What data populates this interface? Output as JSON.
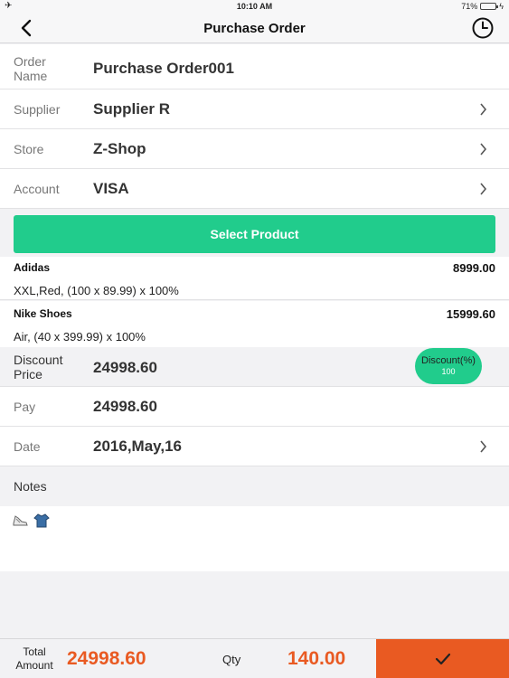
{
  "status_bar": {
    "time": "10:10 AM",
    "battery": "71%",
    "battery_level": 0.71
  },
  "nav": {
    "title": "Purchase Order"
  },
  "form": {
    "order_name_label_line1": "Order",
    "order_name_label_line2": "Name",
    "order_name_value": "Purchase Order001",
    "supplier_label": "Supplier",
    "supplier_value": "Supplier R",
    "store_label": "Store",
    "store_value": "Z-Shop",
    "account_label": "Account",
    "account_value": "VISA"
  },
  "select_product_label": "Select Product",
  "products": [
    {
      "name": "Adidas",
      "price": "8999.00",
      "desc": "XXL,Red, (100  x 89.99) x 100%"
    },
    {
      "name": "Nike Shoes",
      "price": "15999.60",
      "desc": "Air, (40  x 399.99) x 100%"
    }
  ],
  "discount": {
    "label_line1": "Discount",
    "label_line2": "Price",
    "value": "24998.60",
    "badge_title": "Discount(%)",
    "badge_value": "100"
  },
  "pay": {
    "label": "Pay",
    "value": "24998.60"
  },
  "date": {
    "label": "Date",
    "value": "2016,May,16"
  },
  "notes": {
    "label": "Notes"
  },
  "footer": {
    "total_label_line1": "Total",
    "total_label_line2": "Amount",
    "total_value": "24998.60",
    "qty_label": "Qty",
    "qty_value": "140.00"
  },
  "colors": {
    "accent_green": "#21cc8c",
    "accent_orange": "#e95a22"
  }
}
